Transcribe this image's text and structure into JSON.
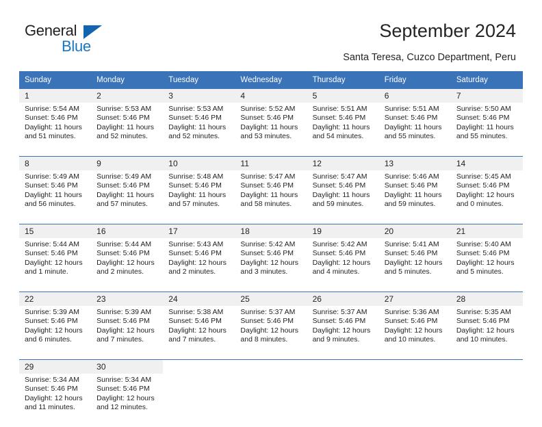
{
  "brand": {
    "name_top": "General",
    "name_bottom": "Blue",
    "accent_color": "#1877c4",
    "triangle_color": "#1263b0"
  },
  "header": {
    "title": "September 2024",
    "subtitle": "Santa Teresa, Cuzco Department, Peru"
  },
  "theme": {
    "header_bg": "#3b73b9",
    "header_text": "#ffffff",
    "daynum_bg": "#f0f0f0",
    "separator": "#3b73b9"
  },
  "calendar": {
    "weekdays": [
      "Sunday",
      "Monday",
      "Tuesday",
      "Wednesday",
      "Thursday",
      "Friday",
      "Saturday"
    ],
    "weeks": [
      [
        {
          "day": "1",
          "sunrise": "Sunrise: 5:54 AM",
          "sunset": "Sunset: 5:46 PM",
          "daylight": "Daylight: 11 hours and 51 minutes."
        },
        {
          "day": "2",
          "sunrise": "Sunrise: 5:53 AM",
          "sunset": "Sunset: 5:46 PM",
          "daylight": "Daylight: 11 hours and 52 minutes."
        },
        {
          "day": "3",
          "sunrise": "Sunrise: 5:53 AM",
          "sunset": "Sunset: 5:46 PM",
          "daylight": "Daylight: 11 hours and 52 minutes."
        },
        {
          "day": "4",
          "sunrise": "Sunrise: 5:52 AM",
          "sunset": "Sunset: 5:46 PM",
          "daylight": "Daylight: 11 hours and 53 minutes."
        },
        {
          "day": "5",
          "sunrise": "Sunrise: 5:51 AM",
          "sunset": "Sunset: 5:46 PM",
          "daylight": "Daylight: 11 hours and 54 minutes."
        },
        {
          "day": "6",
          "sunrise": "Sunrise: 5:51 AM",
          "sunset": "Sunset: 5:46 PM",
          "daylight": "Daylight: 11 hours and 55 minutes."
        },
        {
          "day": "7",
          "sunrise": "Sunrise: 5:50 AM",
          "sunset": "Sunset: 5:46 PM",
          "daylight": "Daylight: 11 hours and 55 minutes."
        }
      ],
      [
        {
          "day": "8",
          "sunrise": "Sunrise: 5:49 AM",
          "sunset": "Sunset: 5:46 PM",
          "daylight": "Daylight: 11 hours and 56 minutes."
        },
        {
          "day": "9",
          "sunrise": "Sunrise: 5:49 AM",
          "sunset": "Sunset: 5:46 PM",
          "daylight": "Daylight: 11 hours and 57 minutes."
        },
        {
          "day": "10",
          "sunrise": "Sunrise: 5:48 AM",
          "sunset": "Sunset: 5:46 PM",
          "daylight": "Daylight: 11 hours and 57 minutes."
        },
        {
          "day": "11",
          "sunrise": "Sunrise: 5:47 AM",
          "sunset": "Sunset: 5:46 PM",
          "daylight": "Daylight: 11 hours and 58 minutes."
        },
        {
          "day": "12",
          "sunrise": "Sunrise: 5:47 AM",
          "sunset": "Sunset: 5:46 PM",
          "daylight": "Daylight: 11 hours and 59 minutes."
        },
        {
          "day": "13",
          "sunrise": "Sunrise: 5:46 AM",
          "sunset": "Sunset: 5:46 PM",
          "daylight": "Daylight: 11 hours and 59 minutes."
        },
        {
          "day": "14",
          "sunrise": "Sunrise: 5:45 AM",
          "sunset": "Sunset: 5:46 PM",
          "daylight": "Daylight: 12 hours and 0 minutes."
        }
      ],
      [
        {
          "day": "15",
          "sunrise": "Sunrise: 5:44 AM",
          "sunset": "Sunset: 5:46 PM",
          "daylight": "Daylight: 12 hours and 1 minute."
        },
        {
          "day": "16",
          "sunrise": "Sunrise: 5:44 AM",
          "sunset": "Sunset: 5:46 PM",
          "daylight": "Daylight: 12 hours and 2 minutes."
        },
        {
          "day": "17",
          "sunrise": "Sunrise: 5:43 AM",
          "sunset": "Sunset: 5:46 PM",
          "daylight": "Daylight: 12 hours and 2 minutes."
        },
        {
          "day": "18",
          "sunrise": "Sunrise: 5:42 AM",
          "sunset": "Sunset: 5:46 PM",
          "daylight": "Daylight: 12 hours and 3 minutes."
        },
        {
          "day": "19",
          "sunrise": "Sunrise: 5:42 AM",
          "sunset": "Sunset: 5:46 PM",
          "daylight": "Daylight: 12 hours and 4 minutes."
        },
        {
          "day": "20",
          "sunrise": "Sunrise: 5:41 AM",
          "sunset": "Sunset: 5:46 PM",
          "daylight": "Daylight: 12 hours and 5 minutes."
        },
        {
          "day": "21",
          "sunrise": "Sunrise: 5:40 AM",
          "sunset": "Sunset: 5:46 PM",
          "daylight": "Daylight: 12 hours and 5 minutes."
        }
      ],
      [
        {
          "day": "22",
          "sunrise": "Sunrise: 5:39 AM",
          "sunset": "Sunset: 5:46 PM",
          "daylight": "Daylight: 12 hours and 6 minutes."
        },
        {
          "day": "23",
          "sunrise": "Sunrise: 5:39 AM",
          "sunset": "Sunset: 5:46 PM",
          "daylight": "Daylight: 12 hours and 7 minutes."
        },
        {
          "day": "24",
          "sunrise": "Sunrise: 5:38 AM",
          "sunset": "Sunset: 5:46 PM",
          "daylight": "Daylight: 12 hours and 7 minutes."
        },
        {
          "day": "25",
          "sunrise": "Sunrise: 5:37 AM",
          "sunset": "Sunset: 5:46 PM",
          "daylight": "Daylight: 12 hours and 8 minutes."
        },
        {
          "day": "26",
          "sunrise": "Sunrise: 5:37 AM",
          "sunset": "Sunset: 5:46 PM",
          "daylight": "Daylight: 12 hours and 9 minutes."
        },
        {
          "day": "27",
          "sunrise": "Sunrise: 5:36 AM",
          "sunset": "Sunset: 5:46 PM",
          "daylight": "Daylight: 12 hours and 10 minutes."
        },
        {
          "day": "28",
          "sunrise": "Sunrise: 5:35 AM",
          "sunset": "Sunset: 5:46 PM",
          "daylight": "Daylight: 12 hours and 10 minutes."
        }
      ],
      [
        {
          "day": "29",
          "sunrise": "Sunrise: 5:34 AM",
          "sunset": "Sunset: 5:46 PM",
          "daylight": "Daylight: 12 hours and 11 minutes."
        },
        {
          "day": "30",
          "sunrise": "Sunrise: 5:34 AM",
          "sunset": "Sunset: 5:46 PM",
          "daylight": "Daylight: 12 hours and 12 minutes."
        },
        null,
        null,
        null,
        null,
        null
      ]
    ]
  }
}
